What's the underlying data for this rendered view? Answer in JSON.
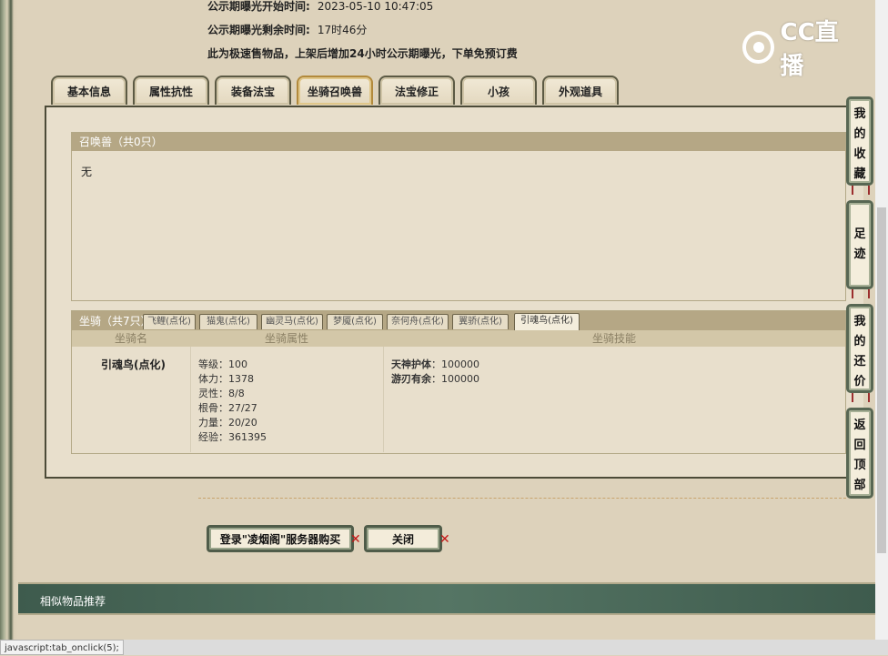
{
  "info": {
    "start_label": "公示期曝光开始时间:",
    "start_value": "2023-05-10 10:47:05",
    "remain_label": "公示期曝光剩余时间:",
    "remain_value": "17时46分",
    "note": "此为极速售物品，上架后增加24小时公示期曝光，下单免预订费"
  },
  "logo": {
    "text": "CC直播",
    "icon": "cc-live-logo-icon"
  },
  "tabs": [
    {
      "label": "基本信息"
    },
    {
      "label": "属性抗性"
    },
    {
      "label": "装备法宝"
    },
    {
      "label": "坐骑召唤兽",
      "active": true
    },
    {
      "label": "法宝修正"
    },
    {
      "label": "小孩"
    },
    {
      "label": "外观道具"
    }
  ],
  "summon": {
    "title": "召唤兽（共0只）",
    "empty_text": "无"
  },
  "mount": {
    "title": "坐骑（共7只）",
    "subtabs": [
      {
        "label": "飞鲤(点化)"
      },
      {
        "label": "猫鬼(点化)"
      },
      {
        "label": "幽灵马(点化)"
      },
      {
        "label": "梦魇(点化)"
      },
      {
        "label": "奈何舟(点化)"
      },
      {
        "label": "翼骄(点化)"
      },
      {
        "label": "引魂鸟(点化)",
        "active": true
      }
    ],
    "columns": [
      "坐骑名",
      "坐骑属性",
      "坐骑技能"
    ],
    "name": "引魂鸟(点化)",
    "attrs": [
      {
        "k": "等级",
        "v": "100"
      },
      {
        "k": "体力",
        "v": "1378"
      },
      {
        "k": "灵性",
        "v": "8/8"
      },
      {
        "k": "根骨",
        "v": "27/27"
      },
      {
        "k": "力量",
        "v": "20/20"
      },
      {
        "k": "经验",
        "v": "361395"
      }
    ],
    "skills": [
      {
        "k": "天神护体",
        "v": "100000"
      },
      {
        "k": "游刃有余",
        "v": "100000"
      }
    ]
  },
  "buttons": {
    "login_buy": "登录\"凌烟阁\"服务器购买",
    "close": "关闭"
  },
  "float_menu": [
    {
      "label": "我的收藏"
    },
    {
      "label": "足迹"
    },
    {
      "label": "我的还价"
    },
    {
      "label": "返回顶部"
    }
  ],
  "similar": {
    "label": "相似物品推荐"
  },
  "status": {
    "text": "javascript:tab_onclick(5);"
  },
  "colors": {
    "panel_bg": "#e8dfcc",
    "header_bg": "#b5a785",
    "frame_green": "#4f5c49",
    "close_x": "#c51818"
  }
}
